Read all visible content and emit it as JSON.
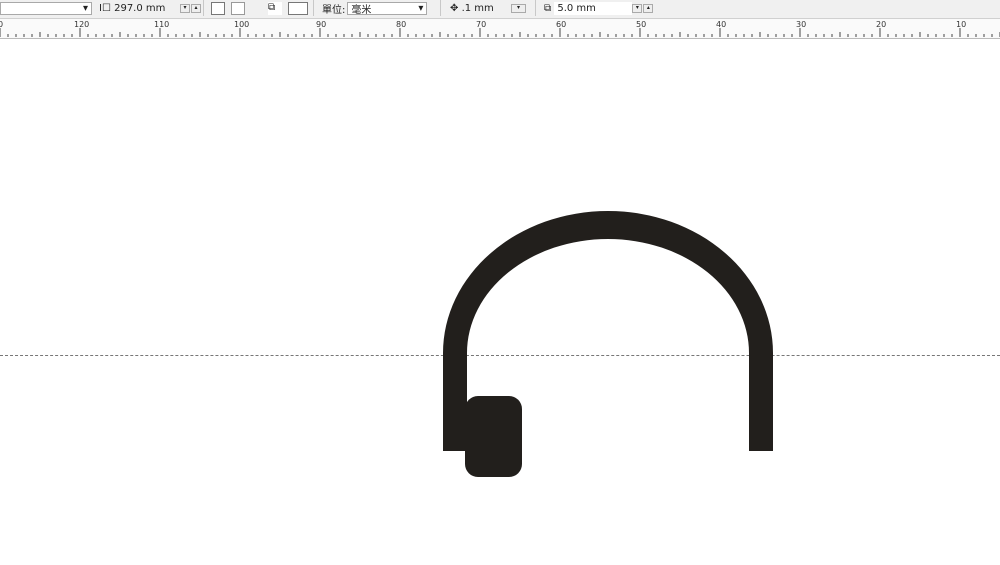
{
  "toolbar": {
    "page_height": "297.0 mm",
    "units_label": "單位:",
    "units_value": "毫米",
    "nudge": ".1 mm",
    "duplicate_distance": "5.0 mm"
  },
  "ruler": {
    "labels": [
      "0",
      "120",
      "110",
      "100",
      "90",
      "80",
      "70",
      "60",
      "50",
      "40",
      "30",
      "20",
      "10"
    ]
  },
  "canvas": {
    "shape": "headphones-icon",
    "fill": "#221f1c"
  }
}
